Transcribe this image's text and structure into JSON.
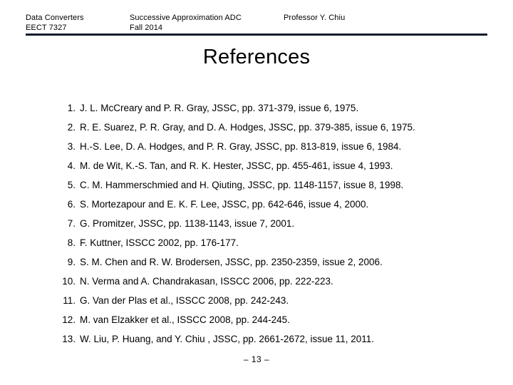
{
  "header": {
    "course_line1": "Data Converters",
    "course_line2": "EECT 7327",
    "topic_line1": "Successive Approximation ADC",
    "topic_line2": "Fall 2014",
    "lecturer": "Professor Y. Chiu",
    "rule_color": "#101c2c"
  },
  "title": "References",
  "references": [
    {
      "num": "1.",
      "text": "J. L. McCreary and P. R. Gray, JSSC, pp. 371-379, issue 6, 1975."
    },
    {
      "num": "2.",
      "text": "R. E. Suarez, P. R. Gray, and D. A. Hodges, JSSC, pp. 379-385, issue 6, 1975."
    },
    {
      "num": "3.",
      "text": "H.-S. Lee, D. A. Hodges, and P. R. Gray, JSSC, pp. 813-819, issue 6, 1984."
    },
    {
      "num": "4.",
      "text": "M. de Wit, K.-S. Tan, and R. K. Hester, JSSC, pp. 455-461, issue 4, 1993."
    },
    {
      "num": "5.",
      "text": "C. M. Hammerschmied and H. Qiuting, JSSC, pp. 1148-1157, issue 8, 1998."
    },
    {
      "num": "6.",
      "text": "S. Mortezapour and E. K. F. Lee, JSSC, pp. 642-646, issue 4, 2000."
    },
    {
      "num": "7.",
      "text": "G. Promitzer, JSSC, pp. 1138-1143, issue 7, 2001."
    },
    {
      "num": "8.",
      "text": "F. Kuttner, ISSCC 2002, pp. 176-177."
    },
    {
      "num": "9.",
      "text": "S. M. Chen and R. W. Brodersen, JSSC, pp. 2350-2359, issue 2, 2006."
    },
    {
      "num": "10.",
      "text": "N. Verma and A. Chandrakasan, ISSCC 2006, pp. 222-223."
    },
    {
      "num": "11.",
      "text": "G. Van der Plas et al., ISSCC 2008, pp. 242-243."
    },
    {
      "num": "12.",
      "text": "M. van Elzakker et al., ISSCC 2008, pp. 244-245."
    },
    {
      "num": "13.",
      "text": "W. Liu, P. Huang, and Y. Chiu , JSSC, pp. 2661-2672, issue 11, 2011."
    }
  ],
  "footer": {
    "page_marker": "– 13 –"
  }
}
